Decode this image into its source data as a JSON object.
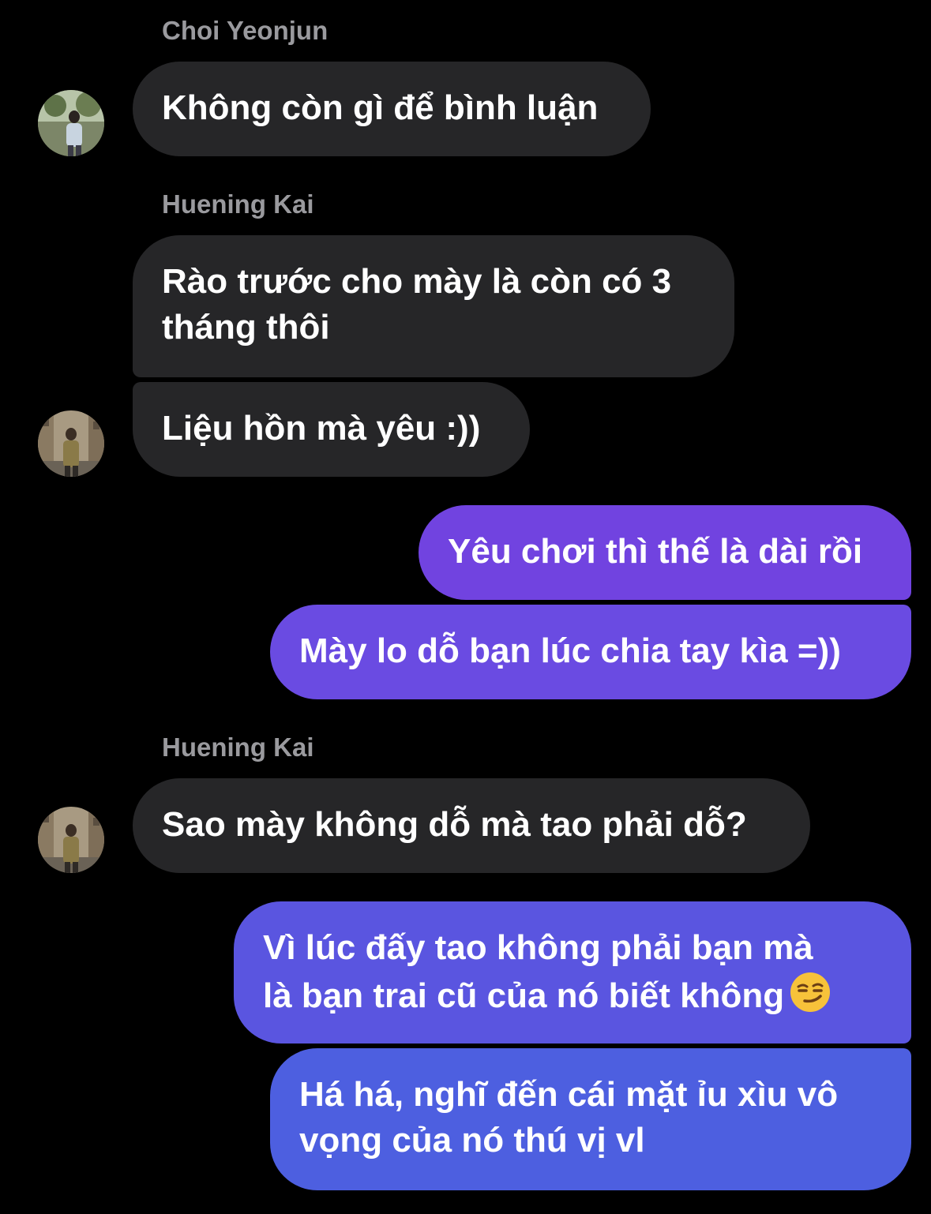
{
  "messages": [
    {
      "type": "sender",
      "text": "Choi Yeonjun"
    },
    {
      "type": "incoming",
      "text": "Không còn gì để bình luận"
    },
    {
      "type": "sender",
      "text": "Huening Kai"
    },
    {
      "type": "incoming",
      "lines": [
        "Rào trước cho mày là còn có 3",
        "tháng thôi"
      ]
    },
    {
      "type": "incoming",
      "text": "Liệu hồn mà yêu :))"
    },
    {
      "type": "outgoing",
      "text": "Yêu chơi thì thế là dài rồi"
    },
    {
      "type": "outgoing",
      "text": "Mày lo dỗ bạn lúc chia tay kìa =))"
    },
    {
      "type": "sender",
      "text": "Huening Kai"
    },
    {
      "type": "incoming",
      "text": "Sao mày không dỗ mà tao phải dỗ?"
    },
    {
      "type": "outgoing",
      "lines": [
        "Vì lúc đấy tao không phải bạn mà",
        "là bạn trai cũ của nó biết không"
      ],
      "emoji": "smirking-face-emoji"
    },
    {
      "type": "outgoing",
      "lines": [
        "Há há, nghĩ đến cái mặt ỉu xìu vô",
        "vọng của nó thú vị vl"
      ]
    }
  ],
  "avatars": [
    {
      "name": "avatar-choi-yeonjun"
    },
    {
      "name": "avatar-huening-kai"
    },
    {
      "name": "avatar-huening-kai"
    }
  ],
  "colors": {
    "background": "#000000",
    "incoming_bubble": "#262628",
    "sender_name": "#9a9a9e",
    "outgoing_gradient_top": "#7440e0",
    "outgoing_gradient_bottom": "#4a63e0"
  }
}
